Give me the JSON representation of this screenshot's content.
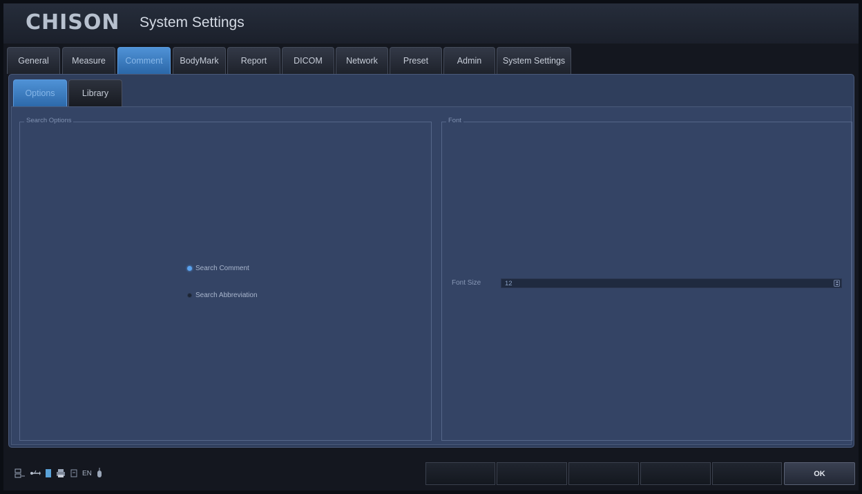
{
  "header": {
    "brand": "CHISON",
    "title": "System Settings"
  },
  "tabs": [
    {
      "label": "General"
    },
    {
      "label": "Measure"
    },
    {
      "label": "Comment"
    },
    {
      "label": "BodyMark"
    },
    {
      "label": "Report"
    },
    {
      "label": "DICOM"
    },
    {
      "label": "Network"
    },
    {
      "label": "Preset"
    },
    {
      "label": "Admin"
    },
    {
      "label": "System Settings"
    }
  ],
  "active_tab": "Comment",
  "subtabs": [
    {
      "label": "Options"
    },
    {
      "label": "Library"
    }
  ],
  "active_subtab": "Options",
  "search_options": {
    "legend": "Search Options",
    "radios": [
      {
        "label": "Search Comment",
        "checked": true
      },
      {
        "label": "Search Abbreviation",
        "checked": false
      }
    ]
  },
  "font": {
    "legend": "Font",
    "font_size_label": "Font Size",
    "font_size_value": "12"
  },
  "statusbar": {
    "language": "EN",
    "icons": [
      "network-icon",
      "usb-icon",
      "storage-icon",
      "printer-icon",
      "printer-status-icon",
      "mouse-icon"
    ],
    "ok_label": "OK"
  },
  "colors": {
    "accent": "#4f92d6",
    "panel": "#344465",
    "titlebar": "#222835"
  }
}
